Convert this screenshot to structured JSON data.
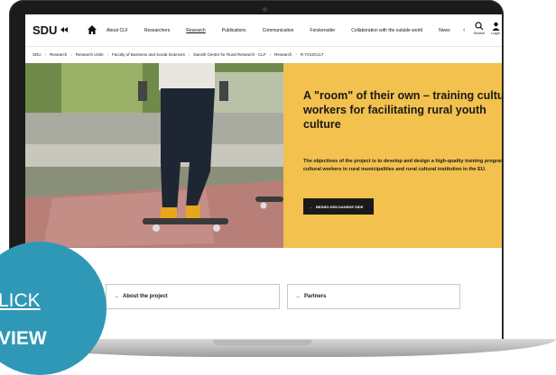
{
  "header": {
    "logo_text": "SDU",
    "nav": [
      "About CLF",
      "Researchers",
      "Research",
      "Publications",
      "Communication",
      "Forskersider",
      "Collaboration with the outside world",
      "News"
    ],
    "search_label": "Search",
    "login_label": "Login"
  },
  "breadcrumb": [
    "SDU",
    "Research",
    "Research Units",
    "Faculty of Business and Social Sciences",
    "Danish Centre for Rural Research - CLF",
    "Research",
    "R YOUCULT"
  ],
  "hero": {
    "title": "A \"room\" of their own – training cultural workers for facilitating rural youth culture",
    "description": "The objectives of the project is to develop and design a high-quality training program for cultural workers in rural municipalities and rural cultural institution in the EU.",
    "button_label": "BESØG DEN DANSKE SIDE",
    "accent_color": "#f2c14e"
  },
  "cards": {
    "about": "About the project",
    "partners": "Partners"
  },
  "overlay": {
    "line1": "LICK",
    "line2": "VIEW",
    "color": "#2f98b6"
  }
}
